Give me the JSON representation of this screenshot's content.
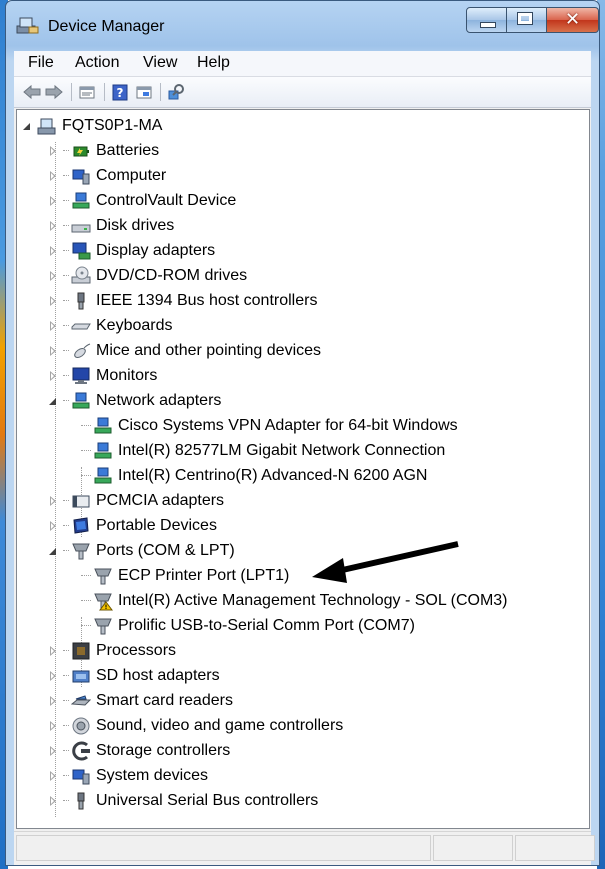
{
  "window": {
    "title": "Device Manager"
  },
  "menu": {
    "file": "File",
    "action": "Action",
    "view": "View",
    "help": "Help"
  },
  "toolbar": {
    "back_icon": "back-arrow-icon",
    "forward_icon": "forward-arrow-icon",
    "properties_icon": "properties-icon",
    "help_icon": "help-icon",
    "update_icon": "update-driver-icon",
    "scan_icon": "scan-hardware-icon"
  },
  "tree": {
    "root": "FQTS0P1-MA",
    "categories": [
      {
        "label": "Batteries",
        "icon": "battery-icon"
      },
      {
        "label": "Computer",
        "icon": "computer-icon"
      },
      {
        "label": "ControlVault Device",
        "icon": "network-device-icon"
      },
      {
        "label": "Disk drives",
        "icon": "disk-drive-icon"
      },
      {
        "label": "Display adapters",
        "icon": "display-adapter-icon"
      },
      {
        "label": "DVD/CD-ROM drives",
        "icon": "dvd-drive-icon"
      },
      {
        "label": "IEEE 1394 Bus host controllers",
        "icon": "ieee1394-icon"
      },
      {
        "label": "Keyboards",
        "icon": "keyboard-icon"
      },
      {
        "label": "Mice and other pointing devices",
        "icon": "mouse-icon"
      },
      {
        "label": "Monitors",
        "icon": "monitor-icon"
      },
      {
        "label": "Network adapters",
        "icon": "network-adapter-icon",
        "children": [
          {
            "label": "Cisco Systems VPN Adapter for 64-bit Windows",
            "icon": "network-adapter-icon"
          },
          {
            "label": "Intel(R) 82577LM Gigabit Network Connection",
            "icon": "network-adapter-icon"
          },
          {
            "label": "Intel(R) Centrino(R) Advanced-N 6200 AGN",
            "icon": "network-adapter-icon"
          }
        ]
      },
      {
        "label": "PCMCIA adapters",
        "icon": "pcmcia-icon"
      },
      {
        "label": "Portable Devices",
        "icon": "portable-device-icon"
      },
      {
        "label": "Ports (COM & LPT)",
        "icon": "port-icon",
        "children": [
          {
            "label": "ECP Printer Port (LPT1)",
            "icon": "port-icon"
          },
          {
            "label": "Intel(R) Active Management Technology - SOL (COM3)",
            "icon": "port-warning-icon"
          },
          {
            "label": "Prolific USB-to-Serial Comm Port (COM7)",
            "icon": "port-icon"
          }
        ]
      },
      {
        "label": "Processors",
        "icon": "processor-icon"
      },
      {
        "label": "SD host adapters",
        "icon": "sd-adapter-icon"
      },
      {
        "label": "Smart card readers",
        "icon": "smart-card-icon"
      },
      {
        "label": "Sound, video and game controllers",
        "icon": "sound-icon"
      },
      {
        "label": "Storage controllers",
        "icon": "storage-controller-icon"
      },
      {
        "label": "System devices",
        "icon": "system-devices-icon"
      },
      {
        "label": "Universal Serial Bus controllers",
        "icon": "usb-icon"
      }
    ]
  },
  "colors": {
    "titlebar": "#9fc3ea",
    "close_button": "#c2361c",
    "tree_background": "#ffffff"
  }
}
